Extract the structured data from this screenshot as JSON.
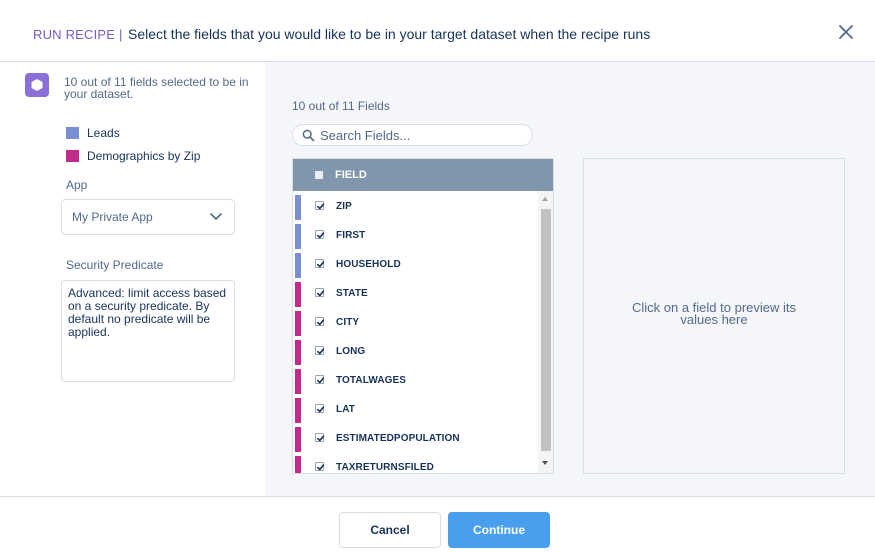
{
  "header": {
    "run_label": "RUN RECIPE |",
    "title": "Select the fields that you would like to be in your target dataset when the recipe runs",
    "close_icon": "close-icon"
  },
  "left": {
    "summary": "10 out of 11 fields selected to be in your dataset.",
    "legend": [
      {
        "label": "Leads",
        "color": "#7a8fd3"
      },
      {
        "label": "Demographics by Zip",
        "color": "#c42a8c"
      }
    ],
    "app_label": "App",
    "app_value": "My Private App",
    "security_label": "Security Predicate",
    "security_text": "Advanced: limit access based on a security predicate. By default no predicate will be applied."
  },
  "fields_panel": {
    "count_label": "10 out of 11 Fields",
    "search_placeholder": "Search Fields...",
    "column_header": "FIELD",
    "rows": [
      {
        "name": "ZIP",
        "source": "Leads",
        "color": "#7a8fd3",
        "checked": true
      },
      {
        "name": "FIRST",
        "source": "Leads",
        "color": "#7a8fd3",
        "checked": true
      },
      {
        "name": "HOUSEHOLD",
        "source": "Leads",
        "color": "#7a8fd3",
        "checked": true
      },
      {
        "name": "STATE",
        "source": "Demographics by Zip",
        "color": "#c42a8c",
        "checked": true
      },
      {
        "name": "CITY",
        "source": "Demographics by Zip",
        "color": "#c42a8c",
        "checked": true
      },
      {
        "name": "LONG",
        "source": "Demographics by Zip",
        "color": "#c42a8c",
        "checked": true
      },
      {
        "name": "TOTALWAGES",
        "source": "Demographics by Zip",
        "color": "#c42a8c",
        "checked": true
      },
      {
        "name": "LAT",
        "source": "Demographics by Zip",
        "color": "#c42a8c",
        "checked": true
      },
      {
        "name": "ESTIMATEDPOPULATION",
        "source": "Demographics by Zip",
        "color": "#c42a8c",
        "checked": true
      },
      {
        "name": "TAXRETURNSFILED",
        "source": "Demographics by Zip",
        "color": "#c42a8c",
        "checked": true
      }
    ]
  },
  "preview": {
    "message": "Click on a field to preview its values here"
  },
  "footer": {
    "cancel_label": "Cancel",
    "continue_label": "Continue"
  },
  "colors": {
    "accent": "#4a9eee",
    "header_run": "#7a5ac8",
    "table_header": "#7f96ad"
  }
}
